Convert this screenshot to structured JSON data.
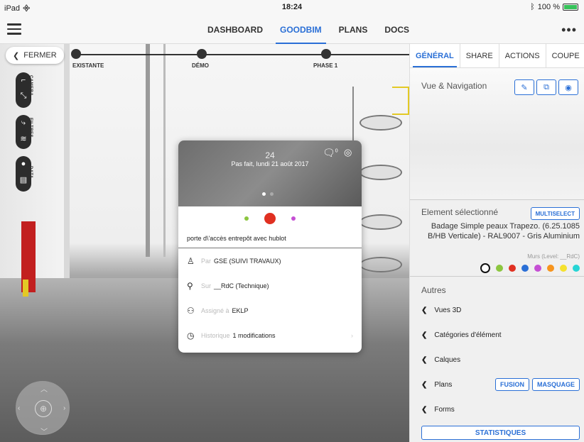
{
  "status_bar": {
    "device": "iPad",
    "time": "18:24",
    "battery": "100 %"
  },
  "nav": {
    "tabs": [
      "DASHBOARD",
      "GOODBIM",
      "PLANS",
      "DOCS"
    ],
    "active": "GOODBIM"
  },
  "viewport": {
    "close_label": "FERMER",
    "timeline": [
      "EXISTANTE",
      "DÉMO",
      "PHASE 1"
    ],
    "tools": [
      "CAMERA",
      "FILTRES",
      "DATA"
    ]
  },
  "card": {
    "photo_day": "24",
    "photo_status": "Pas fait, lundi 21 août 2017",
    "comment_count": "0",
    "colors": [
      "#8cc63f",
      "#e03021",
      "#c54fd4"
    ],
    "title": "porte d\\'accès entrepôt avec hublot",
    "rows": [
      {
        "label": "Par",
        "value": "GSE (SUIVI TRAVAUX)",
        "icon": "person-icon"
      },
      {
        "label": "Sur",
        "value": "__RdC (Technique)",
        "icon": "location-pin-icon"
      },
      {
        "label": "Assigné à",
        "value": "EKLP",
        "icon": "group-icon"
      },
      {
        "label": "Historique",
        "value": "1 modifications",
        "icon": "clock-icon"
      }
    ]
  },
  "panel": {
    "tabs": [
      "GÉNÉRAL",
      "SHARE",
      "ACTIONS",
      "COUPE"
    ],
    "active_tab": "GÉNÉRAL",
    "vue_nav_heading": "Vue & Navigation",
    "element_heading": "Element sélectionné",
    "multiselect_label": "MULTISELECT",
    "element_name": "Badage Simple peaux Trapezo. (6.25.1085 B/HB Verticale) - RAL9007 - Gris Aluminium",
    "element_level": "Murs (Level: __RdC)",
    "element_colors": [
      "#8cc63f",
      "#e03021",
      "#2a6fd6",
      "#c54fd4",
      "#f7941d",
      "#f5e12e",
      "#27d5d5"
    ],
    "autres_heading": "Autres",
    "autres_items": [
      "Vues 3D",
      "Catégories d'élément",
      "Calques",
      "Plans",
      "Forms"
    ],
    "fusion_label": "FUSION",
    "masquage_label": "MASQUAGE",
    "stats_label": "STATISTIQUES"
  }
}
